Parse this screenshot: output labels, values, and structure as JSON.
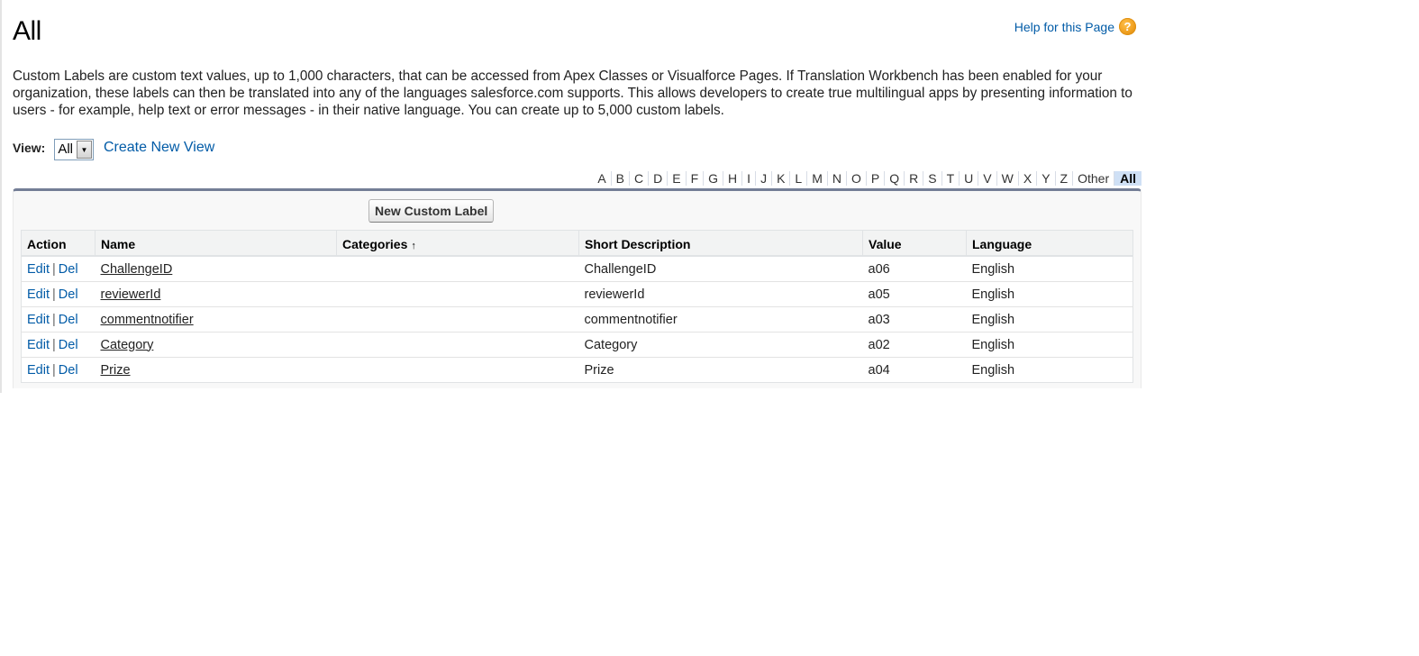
{
  "page": {
    "title": "All",
    "help_link": "Help for this Page",
    "help_icon": "question-circle-icon",
    "description": "Custom Labels are custom text values, up to 1,000 characters, that can be accessed from Apex Classes or Visualforce Pages. If Translation Workbench has been enabled for your organization, these labels can then be translated into any of the languages salesforce.com supports. This allows developers to create true multilingual apps by presenting information to users - for example, help text or error messages - in their native language. You can create up to 5,000 custom labels."
  },
  "view": {
    "label": "View:",
    "selected": "All",
    "dropdown_icon": "chevron-down-icon",
    "create_new_view": "Create New View"
  },
  "alpha_filter": {
    "letters": [
      "A",
      "B",
      "C",
      "D",
      "E",
      "F",
      "G",
      "H",
      "I",
      "J",
      "K",
      "L",
      "M",
      "N",
      "O",
      "P",
      "Q",
      "R",
      "S",
      "T",
      "U",
      "V",
      "W",
      "X",
      "Y",
      "Z",
      "Other",
      "All"
    ],
    "active": "All"
  },
  "list": {
    "new_button": "New Custom Label",
    "columns": {
      "action": "Action",
      "name": "Name",
      "categories": "Categories",
      "categories_sort": "↑",
      "short_description": "Short Description",
      "value": "Value",
      "language": "Language"
    },
    "action_edit": "Edit",
    "action_sep": "|",
    "action_del": "Del",
    "rows": [
      {
        "name": "ChallengeID",
        "categories": "",
        "short_description": "ChallengeID",
        "value": "a06",
        "language": "English"
      },
      {
        "name": "reviewerId",
        "categories": "",
        "short_description": "reviewerId",
        "value": "a05",
        "language": "English"
      },
      {
        "name": "commentnotifier",
        "categories": "",
        "short_description": "commentnotifier",
        "value": "a03",
        "language": "English"
      },
      {
        "name": "Category",
        "categories": "",
        "short_description": "Category",
        "value": "a02",
        "language": "English"
      },
      {
        "name": "Prize",
        "categories": "",
        "short_description": "Prize",
        "value": "a04",
        "language": "English"
      }
    ]
  },
  "colors": {
    "link": "#015ba7",
    "panel_top_border": "#747e96",
    "active_filter_bg": "#cfe0f5",
    "help_icon": "#f0a020"
  }
}
